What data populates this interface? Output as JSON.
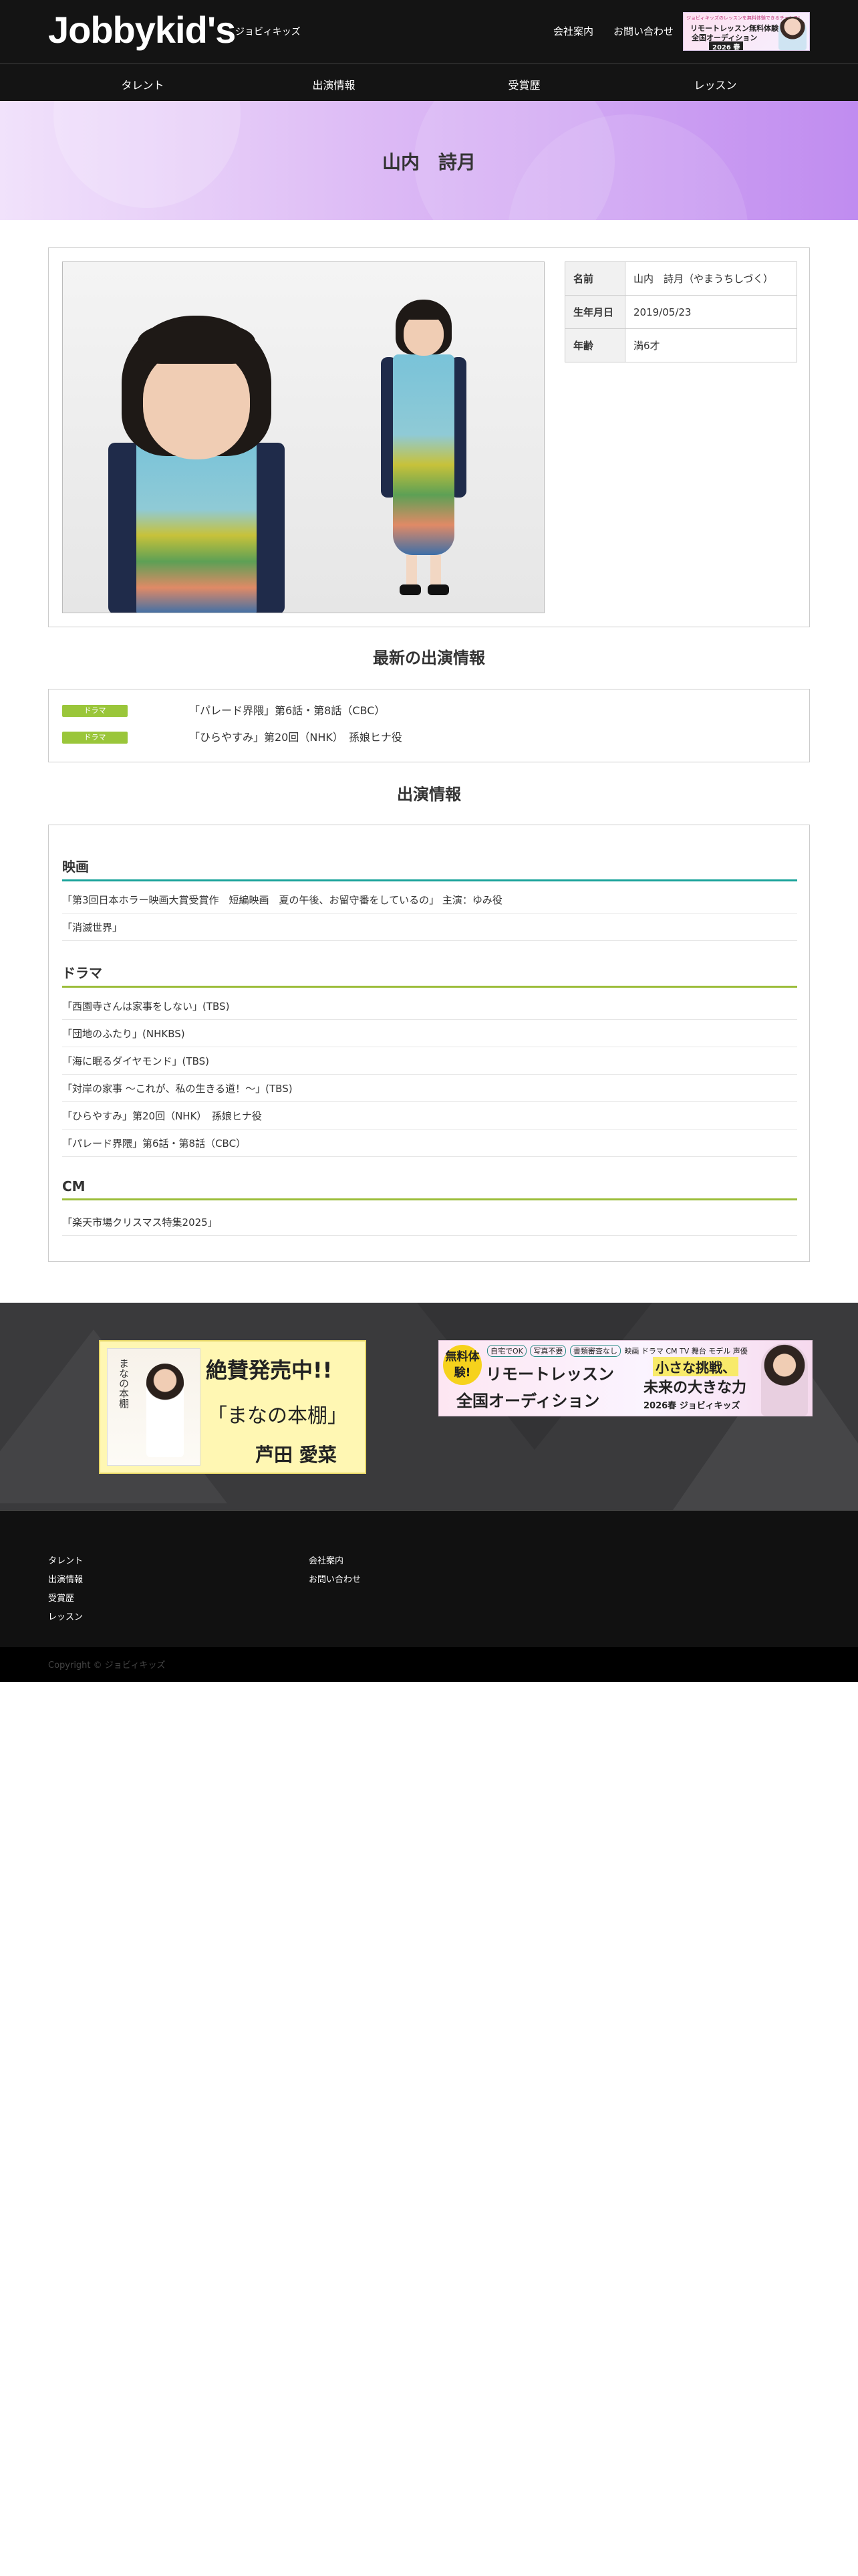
{
  "header": {
    "logo": "Jobbykid's",
    "logo_sub": "ジョビィキッズ",
    "links": [
      "会社案内",
      "お問い合わせ"
    ],
    "banner": {
      "top": "ジョビィキッズのレッスンを無料体験できるチャンス!",
      "line1": "リモートレッスン無料体験",
      "line2": "全国オーディション",
      "season": "2026 春"
    }
  },
  "nav": [
    "タレント",
    "出演情報",
    "受賞歴",
    "レッスン"
  ],
  "hero": {
    "title": "山内　詩月"
  },
  "profile": {
    "rows": [
      {
        "key": "名前",
        "value": "山内　詩月（やまうちしづく）"
      },
      {
        "key": "生年月日",
        "value": "2019/05/23"
      },
      {
        "key": "年齢",
        "value": "満6才"
      }
    ]
  },
  "latest": {
    "title": "最新の出演情報",
    "items": [
      {
        "tag": "ドラマ",
        "text": "「パレード界隈」第6話・第8話（CBC）"
      },
      {
        "tag": "ドラマ",
        "text": "「ひらやすみ」第20回（NHK）　孫娘ヒナ役"
      }
    ]
  },
  "appearances": {
    "title": "出演情報",
    "categories": [
      {
        "name": "映画",
        "items": [
          "「第3回日本ホラー映画大賞受賞作　短編映画　夏の午後、お留守番をしているの」 主演：ゆみ役",
          "「消滅世界」"
        ]
      },
      {
        "name": "ドラマ",
        "items": [
          "「西園寺さんは家事をしない」(TBS)",
          "「団地のふたり」(NHKBS)",
          "「海に眠るダイヤモンド」(TBS)",
          "「対岸の家事 〜これが、私の生きる道！〜」(TBS)",
          "「ひらやすみ」第20回（NHK）　孫娘ヒナ役",
          "「パレード界隈」第6話・第8話（CBC）"
        ]
      },
      {
        "name": "CM",
        "items": [
          "「楽天市場クリスマス特集2025」"
        ]
      }
    ]
  },
  "banners": {
    "left": {
      "book_title": "まなの本棚",
      "headline": "絶賛発売中!!",
      "title": "「まなの本棚」",
      "author": "芦田 愛菜"
    },
    "right": {
      "badge": "無料体験!",
      "pills": [
        "自宅でOK",
        "写真不要",
        "書類審査なし"
      ],
      "genres": "映画 ドラマ CM TV 舞台 モデル 声優",
      "line1": "リモートレッスン",
      "line2": "全国オーディション",
      "catch1": "小さな挑戦、",
      "catch2": "未来の大きな力",
      "season": "2026春 ジョビィキッズ"
    }
  },
  "footer": {
    "col1": [
      "タレント",
      "出演情報",
      "受賞歴",
      "レッスン"
    ],
    "col2": [
      "会社案内",
      "お問い合わせ"
    ],
    "copyright": "Copyright © ジョビィキッズ"
  }
}
